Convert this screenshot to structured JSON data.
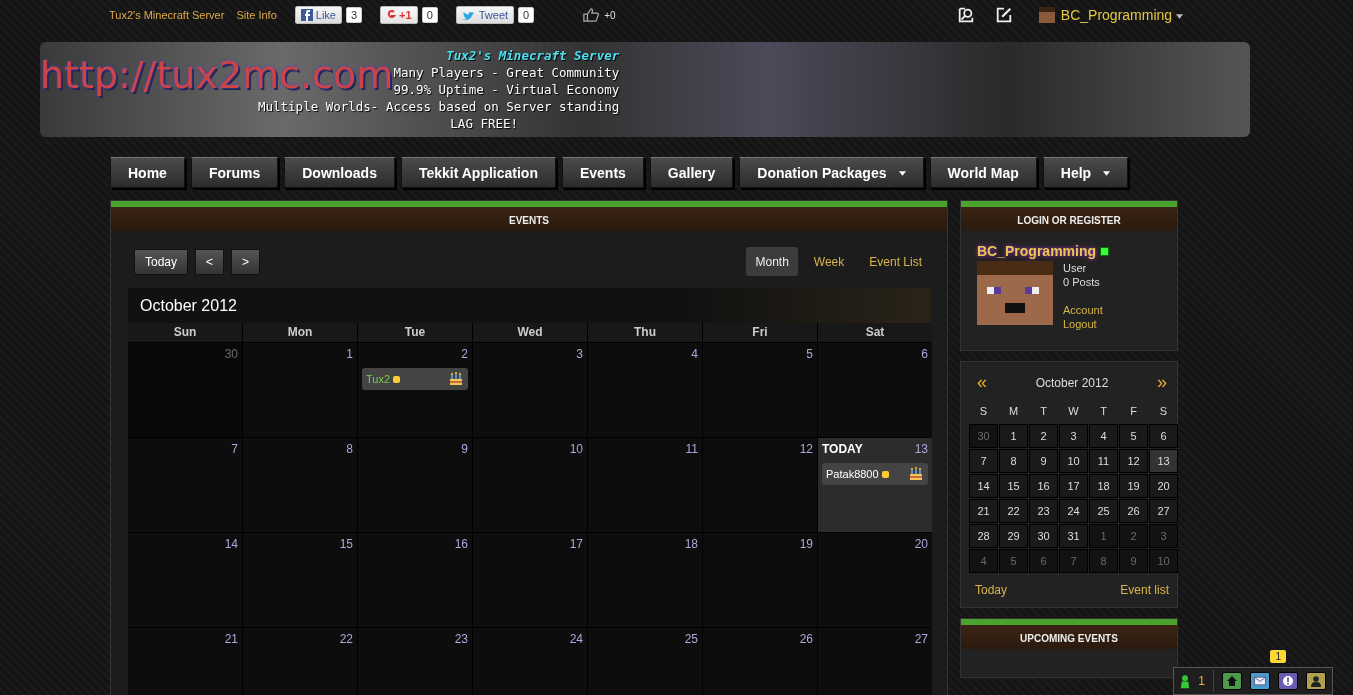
{
  "topbar": {
    "links": [
      "Tux2's Minecraft Server",
      "Site Info"
    ],
    "social": [
      {
        "kind": "facebook",
        "label": "Like",
        "count": "3"
      },
      {
        "kind": "google",
        "label": "+1",
        "count": "0"
      },
      {
        "kind": "twitter",
        "label": "Tweet",
        "count": "0"
      },
      {
        "kind": "thumb",
        "count": "+0"
      }
    ],
    "user": "BC_Programming"
  },
  "banner": {
    "logo": "http://tux2mc.com",
    "title": "Tux2's Minecraft Server",
    "lines": [
      "Many Players - Great Community",
      "99.9% Uptime - Virtual Economy",
      "Multiple Worlds- Access based on Server standing",
      "LAG FREE!"
    ]
  },
  "nav": [
    {
      "label": "Home",
      "dropdown": false
    },
    {
      "label": "Forums",
      "dropdown": false
    },
    {
      "label": "Downloads",
      "dropdown": false
    },
    {
      "label": "Tekkit Application",
      "dropdown": false
    },
    {
      "label": "Events",
      "dropdown": false
    },
    {
      "label": "Gallery",
      "dropdown": false
    },
    {
      "label": "Donation Packages",
      "dropdown": true
    },
    {
      "label": "World Map",
      "dropdown": false
    },
    {
      "label": "Help",
      "dropdown": true
    }
  ],
  "events": {
    "title": "EVENTS",
    "buttons": [
      "Today",
      "<",
      ">"
    ],
    "views": [
      {
        "label": "Month",
        "selected": true
      },
      {
        "label": "Week",
        "selected": false
      },
      {
        "label": "Event List",
        "selected": false
      }
    ],
    "month": "October 2012",
    "today_label": "TODAY",
    "weekdays": [
      "Sun",
      "Mon",
      "Tue",
      "Wed",
      "Thu",
      "Fri",
      "Sat"
    ],
    "weeks": [
      [
        {
          "num": "30",
          "other": true,
          "today": false
        },
        {
          "num": "1",
          "other": false,
          "today": false
        },
        {
          "num": "2",
          "other": false,
          "today": false,
          "events": [
            "Tux2"
          ]
        },
        {
          "num": "3",
          "other": false,
          "today": false
        },
        {
          "num": "4",
          "other": false,
          "today": false
        },
        {
          "num": "5",
          "other": false,
          "today": false
        },
        {
          "num": "6",
          "other": false,
          "today": false
        }
      ],
      [
        {
          "num": "7",
          "other": false,
          "today": false
        },
        {
          "num": "8",
          "other": false,
          "today": false
        },
        {
          "num": "9",
          "other": false,
          "today": false
        },
        {
          "num": "10",
          "other": false,
          "today": false
        },
        {
          "num": "11",
          "other": false,
          "today": false
        },
        {
          "num": "12",
          "other": false,
          "today": false
        },
        {
          "num": "13",
          "other": false,
          "today": true,
          "events": [
            "Patak8800"
          ]
        }
      ],
      [
        {
          "num": "14",
          "other": false,
          "today": false
        },
        {
          "num": "15",
          "other": false,
          "today": false
        },
        {
          "num": "16",
          "other": false,
          "today": false
        },
        {
          "num": "17",
          "other": false,
          "today": false
        },
        {
          "num": "18",
          "other": false,
          "today": false
        },
        {
          "num": "19",
          "other": false,
          "today": false
        },
        {
          "num": "20",
          "other": false,
          "today": false
        }
      ],
      [
        {
          "num": "21",
          "other": false,
          "today": false
        },
        {
          "num": "22",
          "other": false,
          "today": false
        },
        {
          "num": "23",
          "other": false,
          "today": false
        },
        {
          "num": "24",
          "other": false,
          "today": false
        },
        {
          "num": "25",
          "other": false,
          "today": false
        },
        {
          "num": "26",
          "other": false,
          "today": false
        },
        {
          "num": "27",
          "other": false,
          "today": false
        }
      ]
    ]
  },
  "login": {
    "title": "LOGIN OR REGISTER",
    "username": "BC_Programming",
    "role": "User",
    "posts": "0 Posts",
    "links": [
      "Account",
      "Logout"
    ]
  },
  "mini_calendar": {
    "prev": "«",
    "next": "»",
    "month": "October 2012",
    "weekdays": [
      "S",
      "M",
      "T",
      "W",
      "T",
      "F",
      "S"
    ],
    "weeks": [
      [
        {
          "num": "30",
          "other": true,
          "today": false
        },
        {
          "num": "1",
          "other": false,
          "today": false
        },
        {
          "num": "2",
          "other": false,
          "today": false
        },
        {
          "num": "3",
          "other": false,
          "today": false
        },
        {
          "num": "4",
          "other": false,
          "today": false
        },
        {
          "num": "5",
          "other": false,
          "today": false
        },
        {
          "num": "6",
          "other": false,
          "today": false
        }
      ],
      [
        {
          "num": "7",
          "other": false,
          "today": false
        },
        {
          "num": "8",
          "other": false,
          "today": false
        },
        {
          "num": "9",
          "other": false,
          "today": false
        },
        {
          "num": "10",
          "other": false,
          "today": false
        },
        {
          "num": "11",
          "other": false,
          "today": false
        },
        {
          "num": "12",
          "other": false,
          "today": false
        },
        {
          "num": "13",
          "other": false,
          "today": true
        }
      ],
      [
        {
          "num": "14",
          "other": false,
          "today": false
        },
        {
          "num": "15",
          "other": false,
          "today": false
        },
        {
          "num": "16",
          "other": false,
          "today": false
        },
        {
          "num": "17",
          "other": false,
          "today": false
        },
        {
          "num": "18",
          "other": false,
          "today": false
        },
        {
          "num": "19",
          "other": false,
          "today": false
        },
        {
          "num": "20",
          "other": false,
          "today": false
        }
      ],
      [
        {
          "num": "21",
          "other": false,
          "today": false
        },
        {
          "num": "22",
          "other": false,
          "today": false
        },
        {
          "num": "23",
          "other": false,
          "today": false
        },
        {
          "num": "24",
          "other": false,
          "today": false
        },
        {
          "num": "25",
          "other": false,
          "today": false
        },
        {
          "num": "26",
          "other": false,
          "today": false
        },
        {
          "num": "27",
          "other": false,
          "today": false
        }
      ],
      [
        {
          "num": "28",
          "other": false,
          "today": false
        },
        {
          "num": "29",
          "other": false,
          "today": false
        },
        {
          "num": "30",
          "other": false,
          "today": false
        },
        {
          "num": "31",
          "other": false,
          "today": false
        },
        {
          "num": "1",
          "other": true,
          "today": false
        },
        {
          "num": "2",
          "other": true,
          "today": false
        },
        {
          "num": "3",
          "other": true,
          "today": false
        }
      ],
      [
        {
          "num": "4",
          "other": true,
          "today": false
        },
        {
          "num": "5",
          "other": true,
          "today": false
        },
        {
          "num": "6",
          "other": true,
          "today": false
        },
        {
          "num": "7",
          "other": true,
          "today": false
        },
        {
          "num": "8",
          "other": true,
          "today": false
        },
        {
          "num": "9",
          "other": true,
          "today": false
        },
        {
          "num": "10",
          "other": true,
          "today": false
        }
      ]
    ],
    "links": [
      "Today",
      "Event list"
    ]
  },
  "upcoming": {
    "title": "UPCOMING EVENTS"
  },
  "chat_bar": {
    "online": "1",
    "alert_count": "1"
  }
}
